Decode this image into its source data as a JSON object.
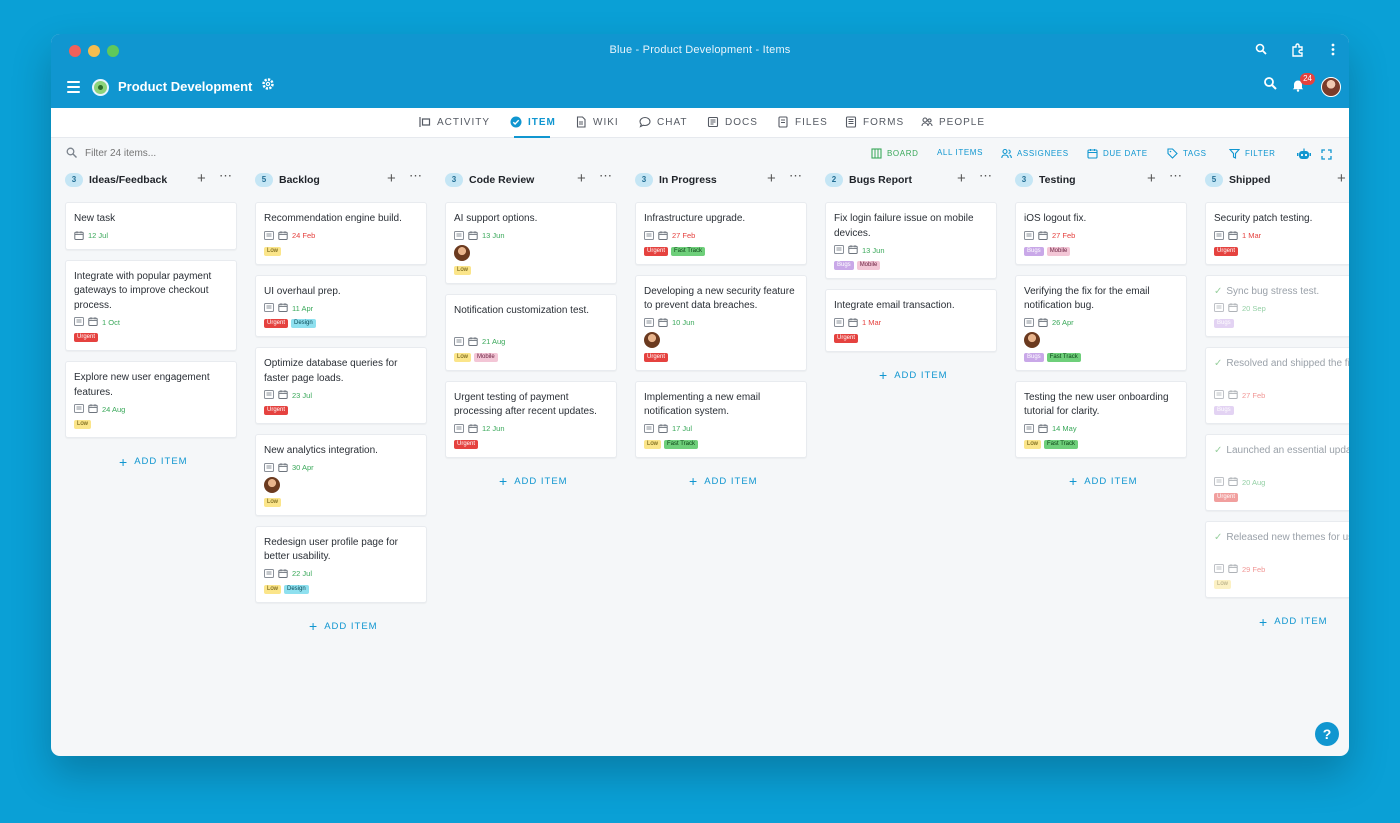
{
  "window": {
    "title": "Blue - Product Development - Items"
  },
  "appbar": {
    "project_name": "Product Development",
    "notifications_count": "24"
  },
  "nav": {
    "tabs": [
      {
        "label": "ACTIVITY",
        "icon": "activity-icon"
      },
      {
        "label": "ITEM",
        "icon": "check-circle-icon",
        "active": true
      },
      {
        "label": "WIKI",
        "icon": "document-icon"
      },
      {
        "label": "CHAT",
        "icon": "chat-icon"
      },
      {
        "label": "DOCS",
        "icon": "docs-icon"
      },
      {
        "label": "FILES",
        "icon": "files-icon"
      },
      {
        "label": "FORMS",
        "icon": "forms-icon"
      },
      {
        "label": "PEOPLE",
        "icon": "people-icon"
      }
    ]
  },
  "toolbar": {
    "filter_placeholder": "Filter 24 items...",
    "board": "BOARD",
    "all_items": "ALL ITEMS",
    "assignees": "ASSIGNEES",
    "due_date": "DUE DATE",
    "tags": "TAGS",
    "filter": "FILTER"
  },
  "colors": {
    "accent": "#1096d0",
    "overdue": "#e5423f",
    "upcoming": "#3aa85a",
    "tag_urgent": "#e5423f",
    "tag_low": "#fbe58a",
    "tag_design": "#8ee0ef",
    "tag_bugs": "#c9a8e8",
    "tag_mobile": "#f3c6d6",
    "tag_fasttrack": "#6ecf7a"
  },
  "add_item_label": "ADD ITEM",
  "columns": [
    {
      "name": "Ideas/Feedback",
      "count": "3",
      "cards": [
        {
          "title": "New task",
          "date": "12 Jul",
          "date_status": "upcoming",
          "tags": []
        },
        {
          "title": "Integrate with popular payment gateways to improve checkout process.",
          "date": "1 Oct",
          "date_status": "upcoming",
          "tags": [
            "Urgent"
          ]
        },
        {
          "title": "Explore new user engagement features.",
          "date": "24 Aug",
          "date_status": "upcoming",
          "tags": [
            "Low"
          ]
        }
      ]
    },
    {
      "name": "Backlog",
      "count": "5",
      "cards": [
        {
          "title": "Recommendation engine build.",
          "date": "24 Feb",
          "date_status": "overdue",
          "tags": [
            "Low"
          ]
        },
        {
          "title": "UI overhaul prep.",
          "date": "11 Apr",
          "date_status": "upcoming",
          "tags": [
            "Urgent",
            "Design"
          ]
        },
        {
          "title": "Optimize database queries for faster page loads.",
          "date": "23 Jul",
          "date_status": "upcoming",
          "tags": [
            "Urgent"
          ]
        },
        {
          "title": "New analytics integration.",
          "date": "30 Apr",
          "date_status": "upcoming",
          "avatar": true,
          "tags": [
            "Low"
          ]
        },
        {
          "title": "Redesign user profile page for better usability.",
          "date": "22 Jul",
          "date_status": "upcoming",
          "tags": [
            "Low",
            "Design"
          ]
        }
      ]
    },
    {
      "name": "Code Review",
      "count": "3",
      "cards": [
        {
          "title": "AI support options.",
          "date": "13 Jun",
          "date_status": "upcoming",
          "avatar": true,
          "tags": [
            "Low"
          ]
        },
        {
          "title": "Notification customization test.",
          "date": "21 Aug",
          "date_status": "upcoming",
          "tags": [
            "Low",
            "Mobile"
          ]
        },
        {
          "title": "Urgent testing of payment processing after recent updates.",
          "date": "12 Jun",
          "date_status": "upcoming",
          "tags": [
            "Urgent"
          ]
        }
      ]
    },
    {
      "name": "In Progress",
      "count": "3",
      "cards": [
        {
          "title": "Infrastructure upgrade.",
          "date": "27 Feb",
          "date_status": "overdue",
          "tags": [
            "Urgent",
            "Fast Track"
          ]
        },
        {
          "title": "Developing a new security feature to prevent data breaches.",
          "date": "10 Jun",
          "date_status": "upcoming",
          "avatar": true,
          "tags": [
            "Urgent"
          ]
        },
        {
          "title": "Implementing a new email notification system.",
          "date": "17 Jul",
          "date_status": "upcoming",
          "tags": [
            "Low",
            "Fast Track"
          ]
        }
      ]
    },
    {
      "name": "Bugs Report",
      "count": "2",
      "cards": [
        {
          "title": "Fix login failure issue on mobile devices.",
          "date": "13 Jun",
          "date_status": "upcoming",
          "tags": [
            "Bugs",
            "Mobile"
          ]
        },
        {
          "title": "Integrate email transaction.",
          "date": "1 Mar",
          "date_status": "overdue",
          "tags": [
            "Urgent"
          ]
        }
      ]
    },
    {
      "name": "Testing",
      "count": "3",
      "cards": [
        {
          "title": "iOS logout fix.",
          "date": "27 Feb",
          "date_status": "overdue",
          "tags": [
            "Bugs",
            "Mobile"
          ]
        },
        {
          "title": "Verifying the fix for the email notification bug.",
          "date": "26 Apr",
          "date_status": "upcoming",
          "avatar": true,
          "tags": [
            "Bugs",
            "Fast Track"
          ]
        },
        {
          "title": "Testing the new user onboarding tutorial for clarity.",
          "date": "14 May",
          "date_status": "upcoming",
          "tags": [
            "Low",
            "Fast Track"
          ]
        }
      ]
    },
    {
      "name": "Shipped",
      "count": "5",
      "cards": [
        {
          "title": "Security patch testing.",
          "date": "1 Mar",
          "date_status": "overdue",
          "tags": [
            "Urgent"
          ]
        },
        {
          "title": "Sync bug stress test.",
          "date": "20 Sep",
          "date_status": "upcoming",
          "done": true,
          "tags": [
            "Bugs"
          ]
        },
        {
          "title": "Resolved and shipped the fix for the user login issue.",
          "date": "27 Feb",
          "date_status": "overdue",
          "done": true,
          "tags": [
            "Bugs"
          ]
        },
        {
          "title": "Launched an essential update to improve system security.",
          "date": "20 Aug",
          "date_status": "upcoming",
          "done": true,
          "tags": [
            "Urgent"
          ]
        },
        {
          "title": "Released new themes for user customization options.",
          "date": "29 Feb",
          "date_status": "overdue",
          "done": true,
          "tags": [
            "Low"
          ]
        }
      ]
    }
  ]
}
